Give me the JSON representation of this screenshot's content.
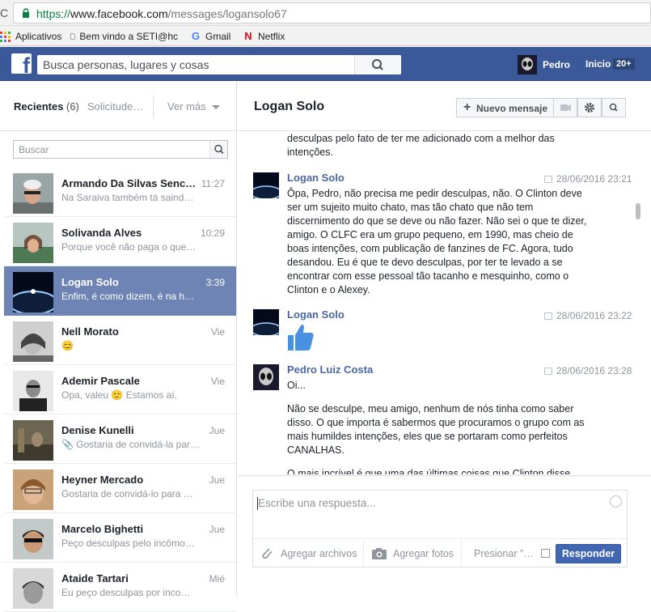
{
  "browser": {
    "url_scheme": "https://",
    "url_host": "www.facebook.com",
    "url_path": "/messages/logansolo67",
    "bookmarks": [
      {
        "label": "Aplicativos",
        "icon": "apps-grid-icon"
      },
      {
        "label": "Bem vindo a SETI@hc",
        "icon": "page-icon"
      },
      {
        "label": "Gmail",
        "icon": "google-icon"
      },
      {
        "label": "Netflix",
        "icon": "netflix-icon"
      }
    ]
  },
  "header": {
    "search_placeholder": "Busca personas, lugares y cosas",
    "user_name": "Pedro",
    "home_label": "Inicio",
    "home_count": "20+",
    "brand_color": "#3b5998"
  },
  "sidebar": {
    "recent_label": "Recientes",
    "recent_count": "(6)",
    "requests_label": "Solicitude…",
    "more_label": "Ver más",
    "search_placeholder": "Buscar",
    "conversations": [
      {
        "name": "Armando Da Silvas Senc…",
        "time": "11:27",
        "snippet": "Na Saraiva também tá saind…"
      },
      {
        "name": "Solivanda Alves",
        "time": "10:29",
        "snippet": "Porque você não paga o que…"
      },
      {
        "name": "Logan Solo",
        "time": "3:39",
        "snippet": "Enfim, é como dizem, é na h…",
        "selected": true
      },
      {
        "name": "Nell Morato",
        "time": "Vie",
        "snippet": "😊"
      },
      {
        "name": "Ademir Pascale",
        "time": "Vie",
        "snippet": "Opa, valeu 🙂 Estamos aí."
      },
      {
        "name": "Denise Kunelli",
        "time": "Jue",
        "snippet": "Gostaria de convidá-la par…"
      },
      {
        "name": "Heyner Mercado",
        "time": "Jue",
        "snippet": "Gostaria de convidá-lo para …"
      },
      {
        "name": "Marcelo Bighetti",
        "time": "Jue",
        "snippet": "Peço desculpas pelo incômo…"
      },
      {
        "name": "Ataide Tartari",
        "time": "Mié",
        "snippet": "Eu peço desculpas por inco…"
      }
    ]
  },
  "chat": {
    "title": "Logan Solo",
    "new_message_label": "Nuevo mensaje",
    "top_text": "desculpas pelo fato de ter me adicionado com a melhor das intenções.",
    "messages": [
      {
        "sender": "Logan Solo",
        "time": "28/06/2016 23:21",
        "text": "Ôpa, Pedro, não precisa me pedir desculpas, não. O Clinton deve ser um sujeito muito chato, mas tão chato que não tem discernimento do que se deve ou não fazer. Não sei o que te dizer, amigo. O CLFC era um grupo pequeno, em 1990, mas cheio de boas intenções, com publicação de fanzines de FC. Agora, tudo desandou. Eu é que te devo desculpas, por ter te levado a se encontrar com esse pessoal tão tacanho e mesquinho, como o Clinton e o Alexey."
      },
      {
        "sender": "Logan Solo",
        "time": "28/06/2016 23:22",
        "text": "thumbs-up-icon"
      },
      {
        "sender": "Pedro Luiz Costa",
        "time": "28/06/2016 23:28",
        "paragraphs": [
          "Oi...",
          "Não se desculpe, meu amigo, nenhum de nós tinha como saber disso. O que importa é sabermos que procuramos o grupo com as mais humildes intenções, eles que se portaram como perfeitos CANALHAS.",
          "O mais incrível é que uma das últimas coisas que Clinton disse"
        ]
      }
    ]
  },
  "composer": {
    "placeholder": "Escribe una respuesta...",
    "attach_label": "Agregar archivos",
    "photos_label": "Agregar fotos",
    "press_label": "Presionar \"…",
    "reply_label": "Responder"
  }
}
